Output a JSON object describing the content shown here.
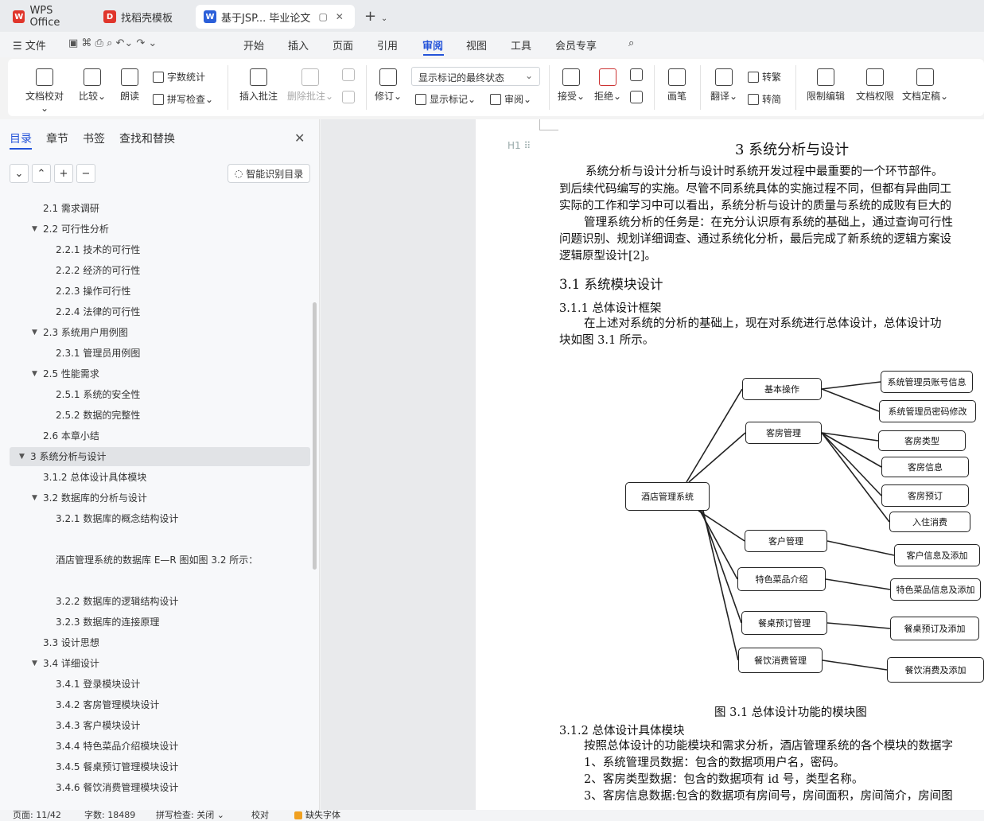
{
  "tabs": [
    {
      "label": "WPS Office",
      "icon": "wps-logo-icon",
      "color": "#e0352b"
    },
    {
      "label": "找稻壳模板",
      "icon": "docer-icon",
      "color": "#e0352b"
    },
    {
      "label": "基于JSP... 毕业论文",
      "icon": "word-doc-icon",
      "color": "#2b5fd9"
    }
  ],
  "menu": {
    "file": "文件",
    "items": [
      "开始",
      "插入",
      "页面",
      "引用",
      "审阅",
      "视图",
      "工具",
      "会员专享"
    ],
    "active": "审阅"
  },
  "ribbon": {
    "doc_proofread": "文档校对",
    "compare": "比较",
    "read_aloud": "朗读",
    "word_count": "字数统计",
    "spell_check": "拼写检查",
    "insert_comment": "插入批注",
    "delete_comment": "删除批注",
    "revise": "修订",
    "markup_state": "显示标记的最终状态",
    "show_markup": "显示标记",
    "review": "审阅",
    "accept": "接受",
    "reject": "拒绝",
    "pen": "画笔",
    "translate": "翻译",
    "to_traditional": "转繁",
    "to_simplified": "转简",
    "restrict_edit": "限制编辑",
    "doc_permission": "文档权限",
    "doc_finalize": "文档定稿"
  },
  "nav": {
    "tabs": [
      "目录",
      "章节",
      "书签",
      "查找和替换"
    ],
    "smart_toc": "智能识别目录",
    "toc": [
      {
        "label": "2.1 需求调研",
        "level": 2,
        "expand": false
      },
      {
        "label": "2.2 可行性分析",
        "level": 2,
        "expand": true
      },
      {
        "label": "2.2.1 技术的可行性",
        "level": 3,
        "expand": false
      },
      {
        "label": "2.2.2 经济的可行性",
        "level": 3,
        "expand": false
      },
      {
        "label": "2.2.3 操作可行性",
        "level": 3,
        "expand": false
      },
      {
        "label": "2.2.4 法律的可行性",
        "level": 3,
        "expand": false
      },
      {
        "label": "2.3 系统用户用例图",
        "level": 2,
        "expand": true
      },
      {
        "label": "2.3.1 管理员用例图",
        "level": 3,
        "expand": false
      },
      {
        "label": "2.5 性能需求",
        "level": 2,
        "expand": true
      },
      {
        "label": "2.5.1 系统的安全性",
        "level": 3,
        "expand": false
      },
      {
        "label": "2.5.2 数据的完整性",
        "level": 3,
        "expand": false
      },
      {
        "label": "2.6  本章小结",
        "level": 2,
        "expand": false
      },
      {
        "label": "3  系统分析与设计",
        "level": 1,
        "expand": true,
        "selected": true
      },
      {
        "label": "3.1.2  总体设计具体模块",
        "level": 2,
        "expand": false
      },
      {
        "label": "3.2 数据库的分析与设计",
        "level": 2,
        "expand": true
      },
      {
        "label": "3.2.1 数据库的概念结构设计",
        "level": 3,
        "expand": false
      },
      {
        "label": "",
        "level": 3,
        "expand": false
      },
      {
        "label": "酒店管理系统的数据库 E—R 图如图 3.2 所示：",
        "level": 3,
        "expand": false
      },
      {
        "label": "",
        "level": 3,
        "expand": false
      },
      {
        "label": "3.2.2 数据库的逻辑结构设计",
        "level": 3,
        "expand": false
      },
      {
        "label": "3.2.3 数据库的连接原理",
        "level": 3,
        "expand": false
      },
      {
        "label": "3.3  设计思想",
        "level": 2,
        "expand": false
      },
      {
        "label": "3.4  详细设计",
        "level": 2,
        "expand": true
      },
      {
        "label": "3.4.1  登录模块设计",
        "level": 3,
        "expand": false
      },
      {
        "label": "3.4.2  客房管理模块设计",
        "level": 3,
        "expand": false
      },
      {
        "label": "3.4.3  客户模块设计",
        "level": 3,
        "expand": false
      },
      {
        "label": "3.4.4  特色菜品介绍模块设计",
        "level": 3,
        "expand": false
      },
      {
        "label": "3.4.5  餐桌预订管理模块设计",
        "level": 3,
        "expand": false
      },
      {
        "label": "3.4.6  餐饮消费管理模块设计",
        "level": 3,
        "expand": false
      }
    ]
  },
  "doc": {
    "heading_marker": "H1 ⠿",
    "chapter_title": "3  系统分析与设计",
    "p1_l1": "系统分析与设计分析与设计时系统开发过程中最重要的一个环节部件。",
    "p1_l2": "到后续代码编写的实施。尽管不同系统具体的实施过程不同，但都有异曲同工",
    "p1_l3": "实际的工作和学习中可以看出，系统分析与设计的质量与系统的成败有巨大的",
    "p2_l1": "管理系统分析的任务是：在充分认识原有系统的基础上，通过查询可行性",
    "p2_l2": "问题识别、规划详细调查、通过系统化分析，最后完成了新系统的逻辑方案设",
    "p2_l3": "逻辑原型设计[2]。",
    "h2_31": "3.1 系统模块设计",
    "h3_311": "3.1.1      总体设计框架",
    "p3_l1": "在上述对系统的分析的基础上，现在对系统进行总体设计，总体设计功",
    "p3_l2": "块如图  3.1 所示。",
    "figure_caption": "图 3.1  总体设计功能的模块图",
    "h3_312": "3.1.2      总体设计具体模块",
    "p4_l1": "按照总体设计的功能模块和需求分析，酒店管理系统的各个模块的数据字",
    "p4_l2": "1、系统管理员数据：包含的数据项用户名，密码。",
    "p4_l3": "2、客房类型数据：包含的数据项有 id 号，类型名称。",
    "p4_l4": "3、客房信息数据:包含的数据项有房间号，房间面积，房间简介，房间图"
  },
  "diagram": {
    "root": "酒店管理系统",
    "modules": [
      "基本操作",
      "客房管理",
      "客户管理",
      "特色菜品介绍",
      "餐桌预订管理",
      "餐饮消费管理"
    ],
    "leaves": [
      "系统管理员账号信息",
      "系统管理员密码修改",
      "客房类型",
      "客房信息",
      "客房预订",
      "入住消费",
      "客户信息及添加",
      "特色菜品信息及添加",
      "餐桌预订及添加",
      "餐饮消费及添加"
    ]
  },
  "status": {
    "page": "页面: 11/42",
    "words": "字数: 18489",
    "spell": "拼写检查: 关闭",
    "proof": "校对",
    "missing_font": "缺失字体"
  }
}
